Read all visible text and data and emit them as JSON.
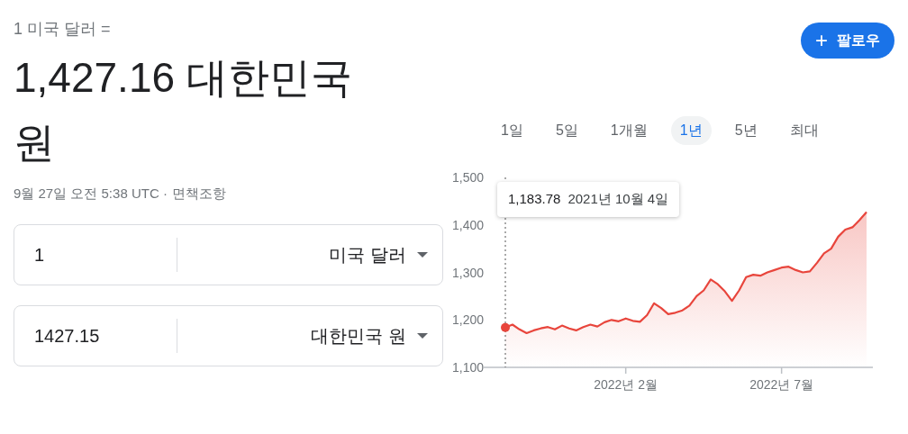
{
  "header": {
    "base_label": "1 미국 달러 =",
    "result": "1,427.16 대한민국 원",
    "timestamp": "9월 27일 오전 5:38 UTC ·",
    "disclaimer": "면책조항"
  },
  "follow_button": {
    "icon": "+",
    "label": "팔로우"
  },
  "converter": [
    {
      "amount": "1",
      "currency": "미국 달러"
    },
    {
      "amount": "1427.15",
      "currency": "대한민국 원"
    }
  ],
  "ranges": [
    {
      "label": "1일",
      "selected": false
    },
    {
      "label": "5일",
      "selected": false
    },
    {
      "label": "1개월",
      "selected": false
    },
    {
      "label": "1년",
      "selected": true
    },
    {
      "label": "5년",
      "selected": false
    },
    {
      "label": "최대",
      "selected": false
    }
  ],
  "chart": {
    "tooltip": {
      "value": "1,183.78",
      "date": "2021년 10월 4일"
    },
    "chart_data": {
      "type": "area",
      "categories": [
        null,
        null,
        null,
        null,
        null,
        null,
        null,
        null,
        null,
        null,
        null,
        null,
        null,
        null,
        null,
        null,
        null,
        "2022년 2월",
        null,
        null,
        null,
        null,
        null,
        null,
        null,
        null,
        null,
        null,
        null,
        null,
        null,
        null,
        null,
        null,
        null,
        null,
        null,
        null,
        null,
        "2022년 7월",
        null,
        null,
        null,
        null,
        null,
        null,
        null,
        null,
        null,
        null,
        null,
        null
      ],
      "series": [
        {
          "color": "#e8453c",
          "values": [
            1184,
            1190,
            1180,
            1172,
            1178,
            1182,
            1185,
            1180,
            1188,
            1182,
            1178,
            1185,
            1190,
            1186,
            1195,
            1200,
            1197,
            1203,
            1198,
            1196,
            1210,
            1235,
            1225,
            1212,
            1215,
            1220,
            1230,
            1250,
            1262,
            1285,
            1275,
            1260,
            1240,
            1262,
            1290,
            1295,
            1293,
            1300,
            1305,
            1310,
            1312,
            1305,
            1300,
            1302,
            1320,
            1340,
            1350,
            1375,
            1390,
            1395,
            1410,
            1427
          ]
        }
      ],
      "ylim": [
        1100,
        1500
      ],
      "yticks": [
        {
          "value": 1100,
          "label": "1,100"
        },
        {
          "value": 1200,
          "label": "1,200"
        },
        {
          "value": 1300,
          "label": "1,300"
        },
        {
          "value": 1400,
          "label": "1,400"
        },
        {
          "value": 1500,
          "label": "1,500"
        }
      ]
    }
  }
}
